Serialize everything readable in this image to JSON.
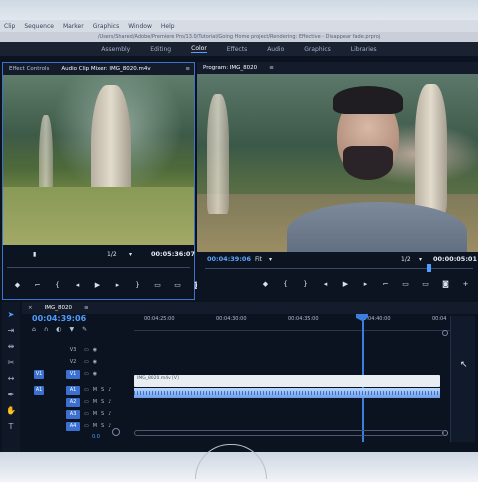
{
  "menubar": {
    "items": [
      "Clip",
      "Sequence",
      "Marker",
      "Graphics",
      "Window",
      "Help"
    ]
  },
  "pathbar": {
    "path": "/Users/Shared/Adobe/Premiere Pro/13.0/Tutorial/Going Home project/Rendering: Effective - Disappear fade.prproj"
  },
  "workspaces": {
    "items": [
      "Assembly",
      "Editing",
      "Color",
      "Effects",
      "Audio",
      "Graphics",
      "Libraries"
    ],
    "active": "Color"
  },
  "source_panel": {
    "tabs": [
      "Effect Controls",
      "Audio Clip Mixer: IMG_8020.m4v"
    ],
    "menu_glyph": "≡",
    "timecode_left": "",
    "fraction": "1/2",
    "timecode_right": "00:05:36:07"
  },
  "program_panel": {
    "tab": "Program: IMG_8020",
    "menu_glyph": "≡",
    "timecode_left": "00:04:39:06",
    "fit": "Fit",
    "fraction": "1/2",
    "timecode_right": "00:00:05:01"
  },
  "timeline": {
    "sequence_tab": "IMG_8020",
    "close_glyph": "×",
    "timecode": "00:04:39:06",
    "ruler_ticks": [
      "00:04:25:00",
      "00:04:30:00",
      "00:04:35:00",
      "00:04:40:00",
      "00:04"
    ],
    "video_tracks": [
      "V3",
      "V2",
      "V1"
    ],
    "audio_tracks": [
      "A1",
      "A2",
      "A3",
      "A4"
    ],
    "clip_label": "IMG_8020.m4v [V]",
    "zero": "0.0"
  },
  "icons": {
    "transport": [
      "mark-in",
      "mark-out",
      "go-to-in",
      "step-back",
      "play",
      "step-forward",
      "go-to-out",
      "insert",
      "overwrite",
      "export-frame",
      "add"
    ],
    "tools": [
      "selection",
      "track-select",
      "ripple-edit",
      "razor",
      "slip",
      "pen",
      "hand",
      "type"
    ]
  },
  "colors": {
    "accent": "#4f9dff",
    "panel_bg": "#0d1421",
    "clip_video": "#e9eef2",
    "clip_audio": "#6c9ee8"
  }
}
